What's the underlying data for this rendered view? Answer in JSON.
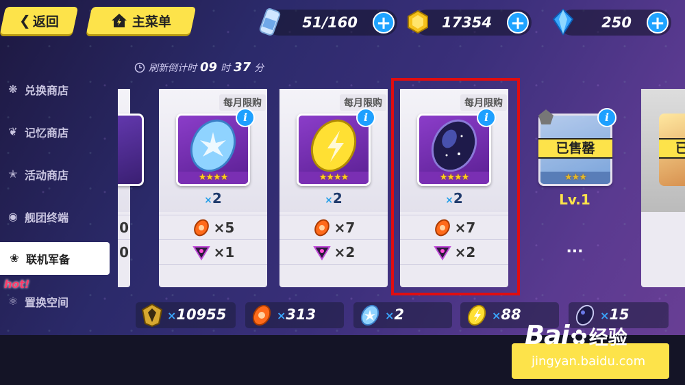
{
  "top_bar": {
    "back_label": "返回",
    "main_menu_label": "主菜单",
    "stamina": "51/160",
    "coins": "17354",
    "crystals": "250"
  },
  "timer": {
    "label": "刷新倒计时",
    "hours": "09",
    "hours_unit": "时",
    "minutes": "37",
    "minutes_unit": "分"
  },
  "sidebar": {
    "items": [
      {
        "label": "兑换商店",
        "icon": "swirl-icon"
      },
      {
        "label": "记忆商店",
        "icon": "feather-icon"
      },
      {
        "label": "活动商店",
        "icon": "star-wing-icon"
      },
      {
        "label": "舰团终端",
        "icon": "eye-icon"
      },
      {
        "label": "联机军备",
        "icon": "group-icon"
      },
      {
        "label": "置换空间",
        "icon": "swap-icon"
      }
    ],
    "hot_label": "hot!"
  },
  "cards": [
    {
      "tag": "每月限购",
      "qty": "2",
      "cost1": "×5",
      "cost2": "×1",
      "color": "#8fd3ff"
    },
    {
      "tag": "每月限购",
      "qty": "2",
      "cost1": "×7",
      "cost2": "×2",
      "color": "#ffe033"
    },
    {
      "tag": "每月限购",
      "qty": "2",
      "cost1": "×7",
      "cost2": "×2",
      "color": "#3a2a7a"
    }
  ],
  "sold_card": {
    "sold_label": "已售罄",
    "level": "Lv.1",
    "more": "...",
    "partial_sold_label": "已"
  },
  "partial_card_rows": [
    "0",
    "0"
  ],
  "currencies": [
    {
      "value": "10955",
      "icon": "crest-icon"
    },
    {
      "value": "313",
      "icon": "orange-chip-icon"
    },
    {
      "value": "2",
      "icon": "blue-chip-icon"
    },
    {
      "value": "88",
      "icon": "yellow-chip-icon"
    },
    {
      "value": "15",
      "icon": "dark-chip-icon"
    }
  ],
  "qty_prefix": "×",
  "watermark": {
    "brand": "Bai",
    "brand2": "经验",
    "url": "jingyan.baidu.com"
  }
}
